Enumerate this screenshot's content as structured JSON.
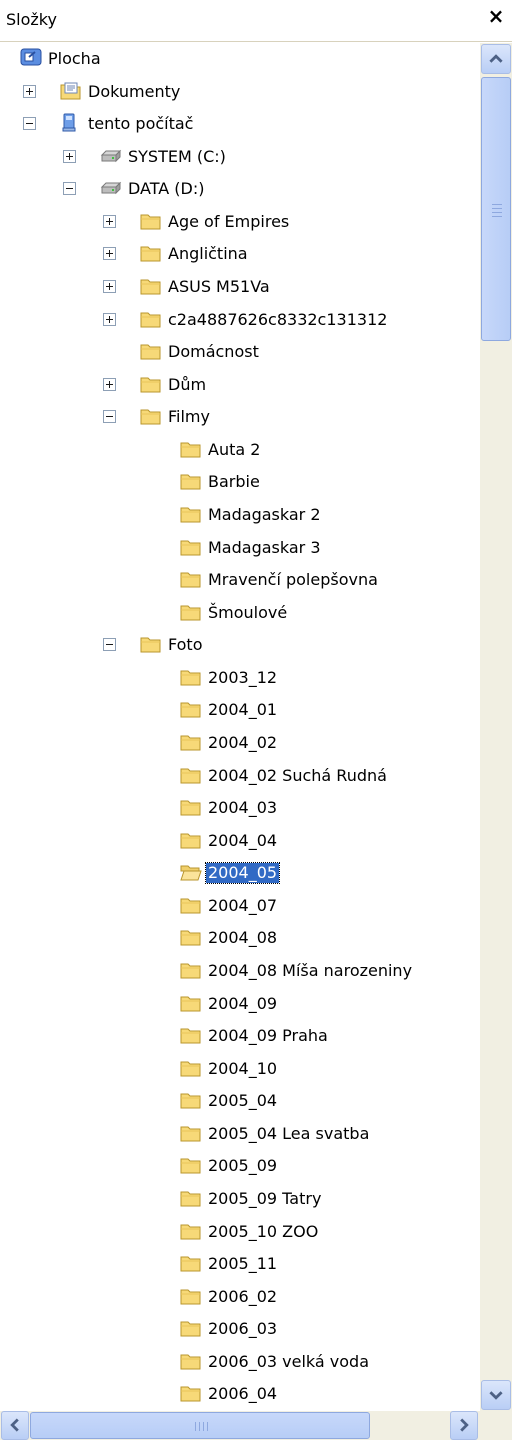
{
  "panel": {
    "title": "Složky",
    "close_label": "×"
  },
  "tree": [
    {
      "label": "Plocha",
      "icon": "desktop-icon",
      "level": 0,
      "expander": "none"
    },
    {
      "label": "Dokumenty",
      "icon": "documents-folder-icon",
      "level": 1,
      "expander": "plus"
    },
    {
      "label": "tento počítač",
      "icon": "computer-icon",
      "level": 1,
      "expander": "minus"
    },
    {
      "label": "SYSTEM (C:)",
      "icon": "drive-icon",
      "level": 2,
      "expander": "plus"
    },
    {
      "label": "DATA (D:)",
      "icon": "drive-icon",
      "level": 2,
      "expander": "minus"
    },
    {
      "label": "Age of Empires",
      "icon": "folder-icon",
      "level": 3,
      "expander": "plus"
    },
    {
      "label": "Angličtina",
      "icon": "folder-icon",
      "level": 3,
      "expander": "plus"
    },
    {
      "label": "ASUS M51Va",
      "icon": "folder-icon",
      "level": 3,
      "expander": "plus"
    },
    {
      "label": "c2a4887626c8332c131312",
      "icon": "folder-icon",
      "level": 3,
      "expander": "plus"
    },
    {
      "label": "Domácnost",
      "icon": "folder-icon",
      "level": 3,
      "expander": "none"
    },
    {
      "label": "Dům",
      "icon": "folder-icon",
      "level": 3,
      "expander": "plus"
    },
    {
      "label": "Filmy",
      "icon": "folder-icon",
      "level": 3,
      "expander": "minus"
    },
    {
      "label": "Auta 2",
      "icon": "folder-icon",
      "level": 4,
      "expander": "none"
    },
    {
      "label": "Barbie",
      "icon": "folder-icon",
      "level": 4,
      "expander": "none"
    },
    {
      "label": "Madagaskar 2",
      "icon": "folder-icon",
      "level": 4,
      "expander": "none"
    },
    {
      "label": "Madagaskar 3",
      "icon": "folder-icon",
      "level": 4,
      "expander": "none"
    },
    {
      "label": "Mravenčí polepšovna",
      "icon": "folder-icon",
      "level": 4,
      "expander": "none"
    },
    {
      "label": "Šmoulové",
      "icon": "folder-icon",
      "level": 4,
      "expander": "none"
    },
    {
      "label": "Foto",
      "icon": "folder-icon",
      "level": 3,
      "expander": "minus"
    },
    {
      "label": "2003_12",
      "icon": "folder-icon",
      "level": 4,
      "expander": "none"
    },
    {
      "label": "2004_01",
      "icon": "folder-icon",
      "level": 4,
      "expander": "none"
    },
    {
      "label": "2004_02",
      "icon": "folder-icon",
      "level": 4,
      "expander": "none"
    },
    {
      "label": "2004_02 Suchá Rudná",
      "icon": "folder-icon",
      "level": 4,
      "expander": "none"
    },
    {
      "label": "2004_03",
      "icon": "folder-icon",
      "level": 4,
      "expander": "none"
    },
    {
      "label": "2004_04",
      "icon": "folder-icon",
      "level": 4,
      "expander": "none"
    },
    {
      "label": "2004_05",
      "icon": "open-folder-icon",
      "level": 4,
      "expander": "none",
      "selected": true
    },
    {
      "label": "2004_07",
      "icon": "folder-icon",
      "level": 4,
      "expander": "none"
    },
    {
      "label": "2004_08",
      "icon": "folder-icon",
      "level": 4,
      "expander": "none"
    },
    {
      "label": "2004_08 Míša  narozeniny",
      "icon": "folder-icon",
      "level": 4,
      "expander": "none"
    },
    {
      "label": "2004_09",
      "icon": "folder-icon",
      "level": 4,
      "expander": "none"
    },
    {
      "label": "2004_09 Praha",
      "icon": "folder-icon",
      "level": 4,
      "expander": "none"
    },
    {
      "label": "2004_10",
      "icon": "folder-icon",
      "level": 4,
      "expander": "none"
    },
    {
      "label": "2005_04",
      "icon": "folder-icon",
      "level": 4,
      "expander": "none"
    },
    {
      "label": "2005_04 Lea svatba",
      "icon": "folder-icon",
      "level": 4,
      "expander": "none"
    },
    {
      "label": "2005_09",
      "icon": "folder-icon",
      "level": 4,
      "expander": "none"
    },
    {
      "label": "2005_09 Tatry",
      "icon": "folder-icon",
      "level": 4,
      "expander": "none"
    },
    {
      "label": "2005_10 ZOO",
      "icon": "folder-icon",
      "level": 4,
      "expander": "none"
    },
    {
      "label": "2005_11",
      "icon": "folder-icon",
      "level": 4,
      "expander": "none"
    },
    {
      "label": "2006_02",
      "icon": "folder-icon",
      "level": 4,
      "expander": "none"
    },
    {
      "label": "2006_03",
      "icon": "folder-icon",
      "level": 4,
      "expander": "none"
    },
    {
      "label": "2006_03 velká voda",
      "icon": "folder-icon",
      "level": 4,
      "expander": "none"
    },
    {
      "label": "2006_04",
      "icon": "folder-icon",
      "level": 4,
      "expander": "none"
    }
  ],
  "colors": {
    "selection": "#316ac5",
    "folder": "#f7d978",
    "scrollbar": "#c1d3fb"
  }
}
